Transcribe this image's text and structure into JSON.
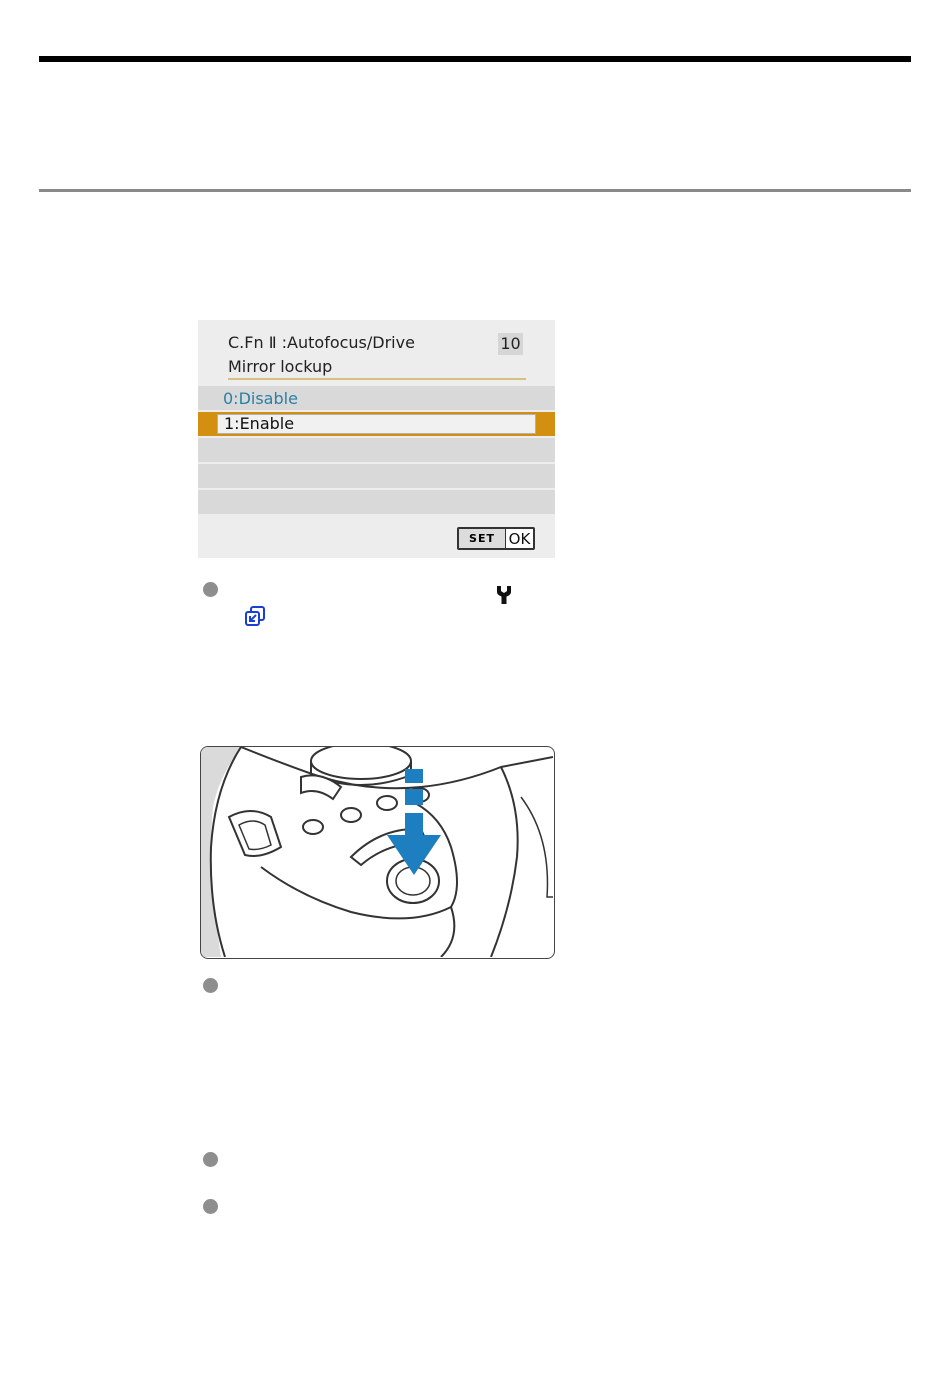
{
  "menu": {
    "category": "C.Fn Ⅱ :Autofocus/Drive",
    "number": "10",
    "title": "Mirror lockup",
    "options": [
      "0:Disable",
      "1:Enable"
    ],
    "selected_index": 1,
    "set_label": "SET",
    "ok_label": "OK"
  },
  "icons": {
    "wrench": "wrench-icon",
    "link": "external-link-icon",
    "accent": "#1a3fd4"
  },
  "colors": {
    "highlight": "#d28f10",
    "option_text": "#2b7fa6",
    "arrow": "#1e7fc0"
  }
}
